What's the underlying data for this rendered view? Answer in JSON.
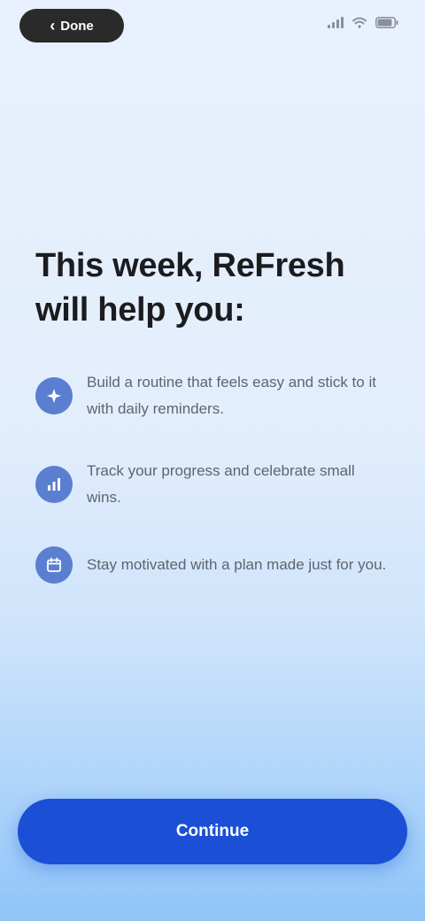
{
  "status_bar": {
    "back_label": "Done",
    "back_icon": "chevron-left-icon",
    "icons": [
      "signal-icon",
      "wifi-icon",
      "battery-icon"
    ]
  },
  "headline": {
    "line1": "This week, ReFresh",
    "line2": "will help you:"
  },
  "features": [
    {
      "icon": "sparkle-icon",
      "text": "Build a routine that feels easy and stick to it with daily reminders."
    },
    {
      "icon": "chart-icon",
      "text": "Track your progress and celebrate small wins."
    },
    {
      "icon": "calendar-icon",
      "text": "Stay motivated with a plan made just for you."
    }
  ],
  "cta": {
    "label": "Continue"
  },
  "colors": {
    "accent": "#1a4fd6",
    "feature_icon_bg": "#5b7fd0",
    "headline": "#1c1c1e"
  }
}
